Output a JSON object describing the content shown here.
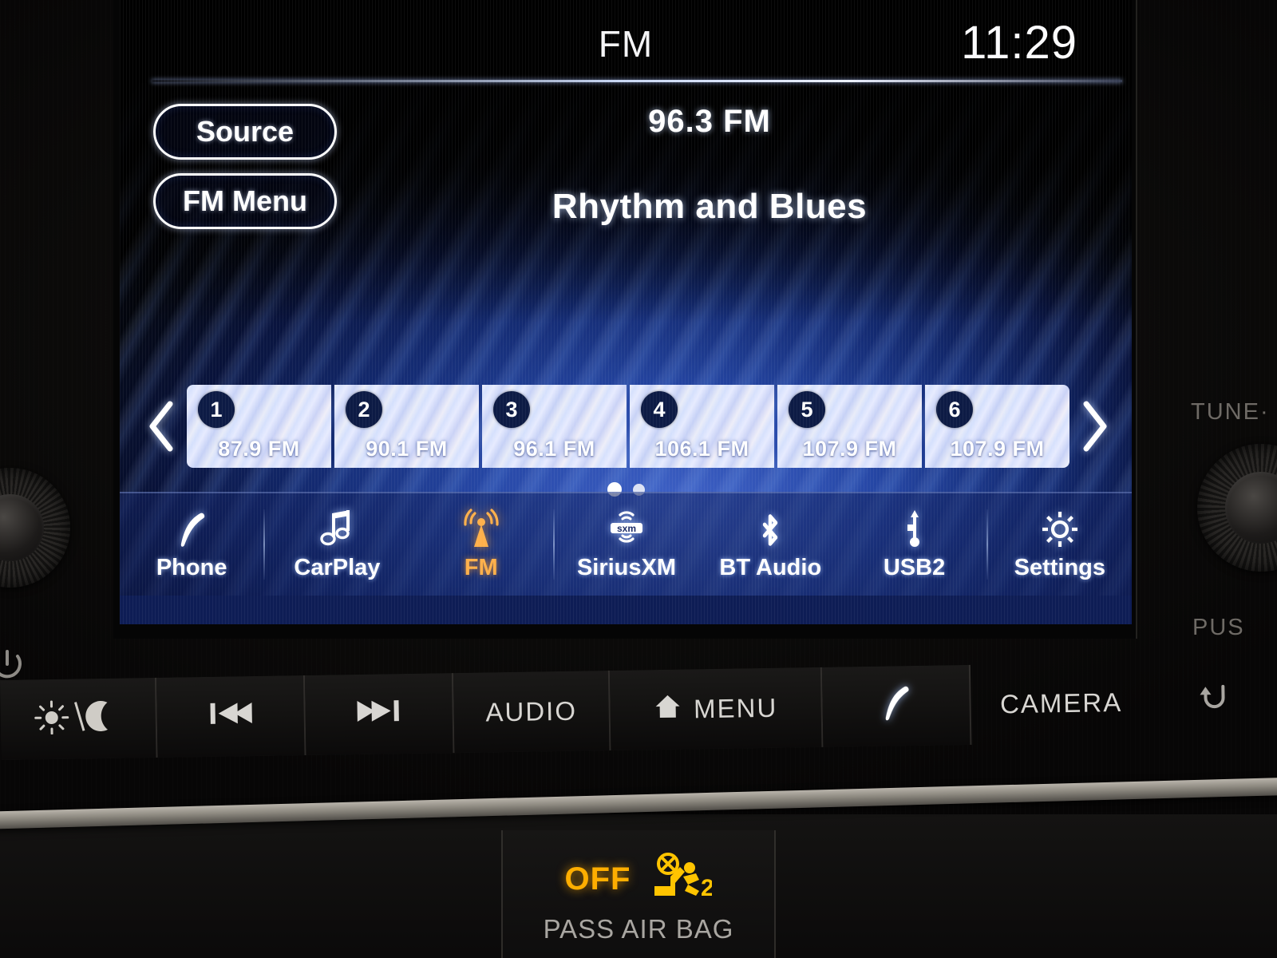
{
  "screen": {
    "statusbar": {
      "title": "FM",
      "clock": "11:29"
    },
    "buttons": {
      "source": "Source",
      "fm_menu": "FM Menu"
    },
    "now_playing": {
      "frequency": "96.3  FM",
      "genre": "Rhythm and Blues"
    },
    "presets": {
      "prev_arrow": "chevron-left-icon",
      "next_arrow": "chevron-right-icon",
      "items": [
        {
          "number": "1",
          "frequency": "87.9  FM"
        },
        {
          "number": "2",
          "frequency": "90.1  FM"
        },
        {
          "number": "3",
          "frequency": "96.1  FM"
        },
        {
          "number": "4",
          "frequency": "106.1  FM"
        },
        {
          "number": "5",
          "frequency": "107.9  FM"
        },
        {
          "number": "6",
          "frequency": "107.9  FM"
        }
      ],
      "page_current": 1,
      "page_total": 2
    },
    "navbar": [
      {
        "label": "Phone",
        "icon": "phone-handset-icon",
        "active": false
      },
      {
        "label": "CarPlay",
        "icon": "music-note-icon",
        "active": false
      },
      {
        "label": "FM",
        "icon": "radio-tower-icon",
        "active": true
      },
      {
        "label": "SiriusXM",
        "icon": "sxm-logo-icon",
        "active": false
      },
      {
        "label": "BT Audio",
        "icon": "bluetooth-icon",
        "active": false
      },
      {
        "label": "USB2",
        "icon": "usb-icon",
        "active": false
      },
      {
        "label": "Settings",
        "icon": "gear-icon",
        "active": false
      }
    ]
  },
  "hardware": {
    "buttons": [
      {
        "label": "",
        "icon": "brightness-day-night-icon"
      },
      {
        "label": "",
        "icon": "track-previous-icon"
      },
      {
        "label": "",
        "icon": "track-next-icon"
      },
      {
        "label": "AUDIO",
        "icon": ""
      },
      {
        "label": "MENU",
        "icon": "home-icon"
      },
      {
        "label": "",
        "icon": "phone-handset-icon"
      },
      {
        "label": "CAMERA",
        "icon": ""
      },
      {
        "label": "",
        "icon": "back-arrow-icon"
      }
    ],
    "knob_labels": {
      "tune": "TUNE·",
      "push": "PUS"
    }
  },
  "airbag": {
    "status": "OFF",
    "label": "PASS AIR BAG",
    "icon": "passenger-airbag-off-icon",
    "status_color": "#ffae00"
  },
  "colors": {
    "screen_blue": "#2546a4",
    "accent_amber": "#ffb04a",
    "preset_badge": "#0d1b45",
    "trim_silver": "#b9b4ab"
  }
}
